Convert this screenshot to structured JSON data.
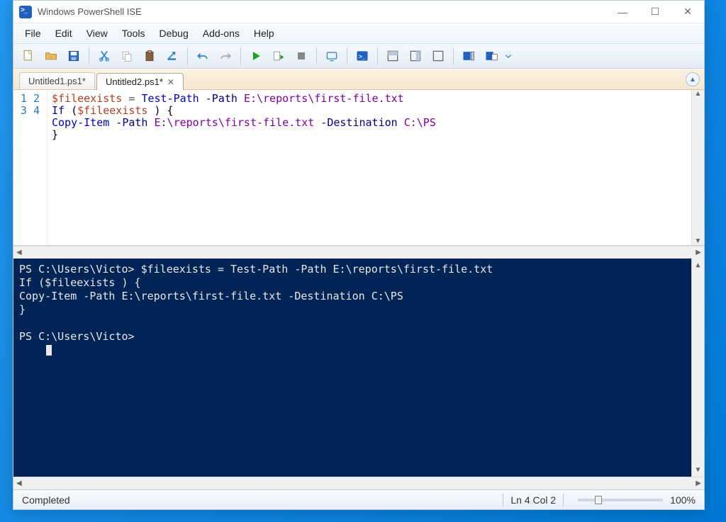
{
  "window": {
    "title": "Windows PowerShell ISE"
  },
  "menu": {
    "file": "File",
    "edit": "Edit",
    "view": "View",
    "tools": "Tools",
    "debug": "Debug",
    "addons": "Add-ons",
    "help": "Help"
  },
  "tabs": [
    {
      "label": "Untitled1.ps1*",
      "active": false,
      "closable": false
    },
    {
      "label": "Untitled2.ps1*",
      "active": true,
      "closable": true
    }
  ],
  "script": {
    "lines": [
      "1",
      "2",
      "3",
      "4"
    ],
    "tokens": [
      [
        {
          "t": "$fileexists",
          "c": "tok-var"
        },
        {
          "t": " = ",
          "c": "tok-op"
        },
        {
          "t": "Test-Path",
          "c": "tok-cmd"
        },
        {
          "t": " -Path ",
          "c": "tok-param"
        },
        {
          "t": "E:\\reports\\first-file.txt",
          "c": "tok-arg"
        }
      ],
      [
        {
          "t": "If",
          "c": "tok-kw"
        },
        {
          "t": " (",
          "c": "tok-punct"
        },
        {
          "t": "$fileexists",
          "c": "tok-var"
        },
        {
          "t": " ) {",
          "c": "tok-punct"
        }
      ],
      [
        {
          "t": "Copy-Item",
          "c": "tok-cmd"
        },
        {
          "t": " -Path ",
          "c": "tok-param"
        },
        {
          "t": "E:\\reports\\first-file.txt",
          "c": "tok-arg"
        },
        {
          "t": " -Destination ",
          "c": "tok-param"
        },
        {
          "t": "C:\\PS",
          "c": "tok-arg"
        }
      ],
      [
        {
          "t": "}",
          "c": "tok-punct"
        }
      ]
    ]
  },
  "console": {
    "lines": [
      "PS C:\\Users\\Victo> $fileexists = Test-Path -Path E:\\reports\\first-file.txt",
      "If ($fileexists ) {",
      "Copy-Item -Path E:\\reports\\first-file.txt -Destination C:\\PS",
      "}",
      "",
      "PS C:\\Users\\Victo>"
    ]
  },
  "status": {
    "left": "Completed",
    "position": "Ln 4  Col 2",
    "zoom": "100%"
  }
}
